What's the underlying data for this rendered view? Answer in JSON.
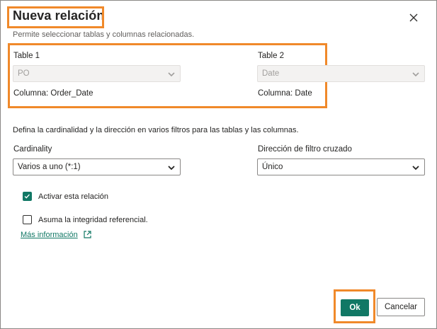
{
  "dialog": {
    "title": "Nueva relación",
    "subtitle": "Permite seleccionar tablas y columnas relacionadas.",
    "close_icon": "close-icon"
  },
  "tables": {
    "table1": {
      "label": "Table 1",
      "value": "PO",
      "column_label": "Columna:",
      "column_value": "Order_Date"
    },
    "table2": {
      "label": "Table 2",
      "value": "Date",
      "column_label": "Columna:",
      "column_value": "Date"
    }
  },
  "description": "Defina la cardinalidad y la dirección en varios filtros para las tablas y las columnas.",
  "cardinality": {
    "label": "Cardinality",
    "value": "Varios a uno (*:1)"
  },
  "cross_filter": {
    "label": "Dirección de filtro cruzado",
    "value": "Único"
  },
  "options": {
    "activate": {
      "label": "Activar esta relación",
      "checked": true
    },
    "integrity": {
      "label": "Asuma la integridad referencial.",
      "checked": false
    }
  },
  "more_info": {
    "label": "Más información",
    "icon": "external-link-icon"
  },
  "buttons": {
    "ok": "Ok",
    "cancel": "Cancelar"
  },
  "colors": {
    "accent": "#117865",
    "highlight": "#f0892a",
    "border": "#8a8886"
  }
}
